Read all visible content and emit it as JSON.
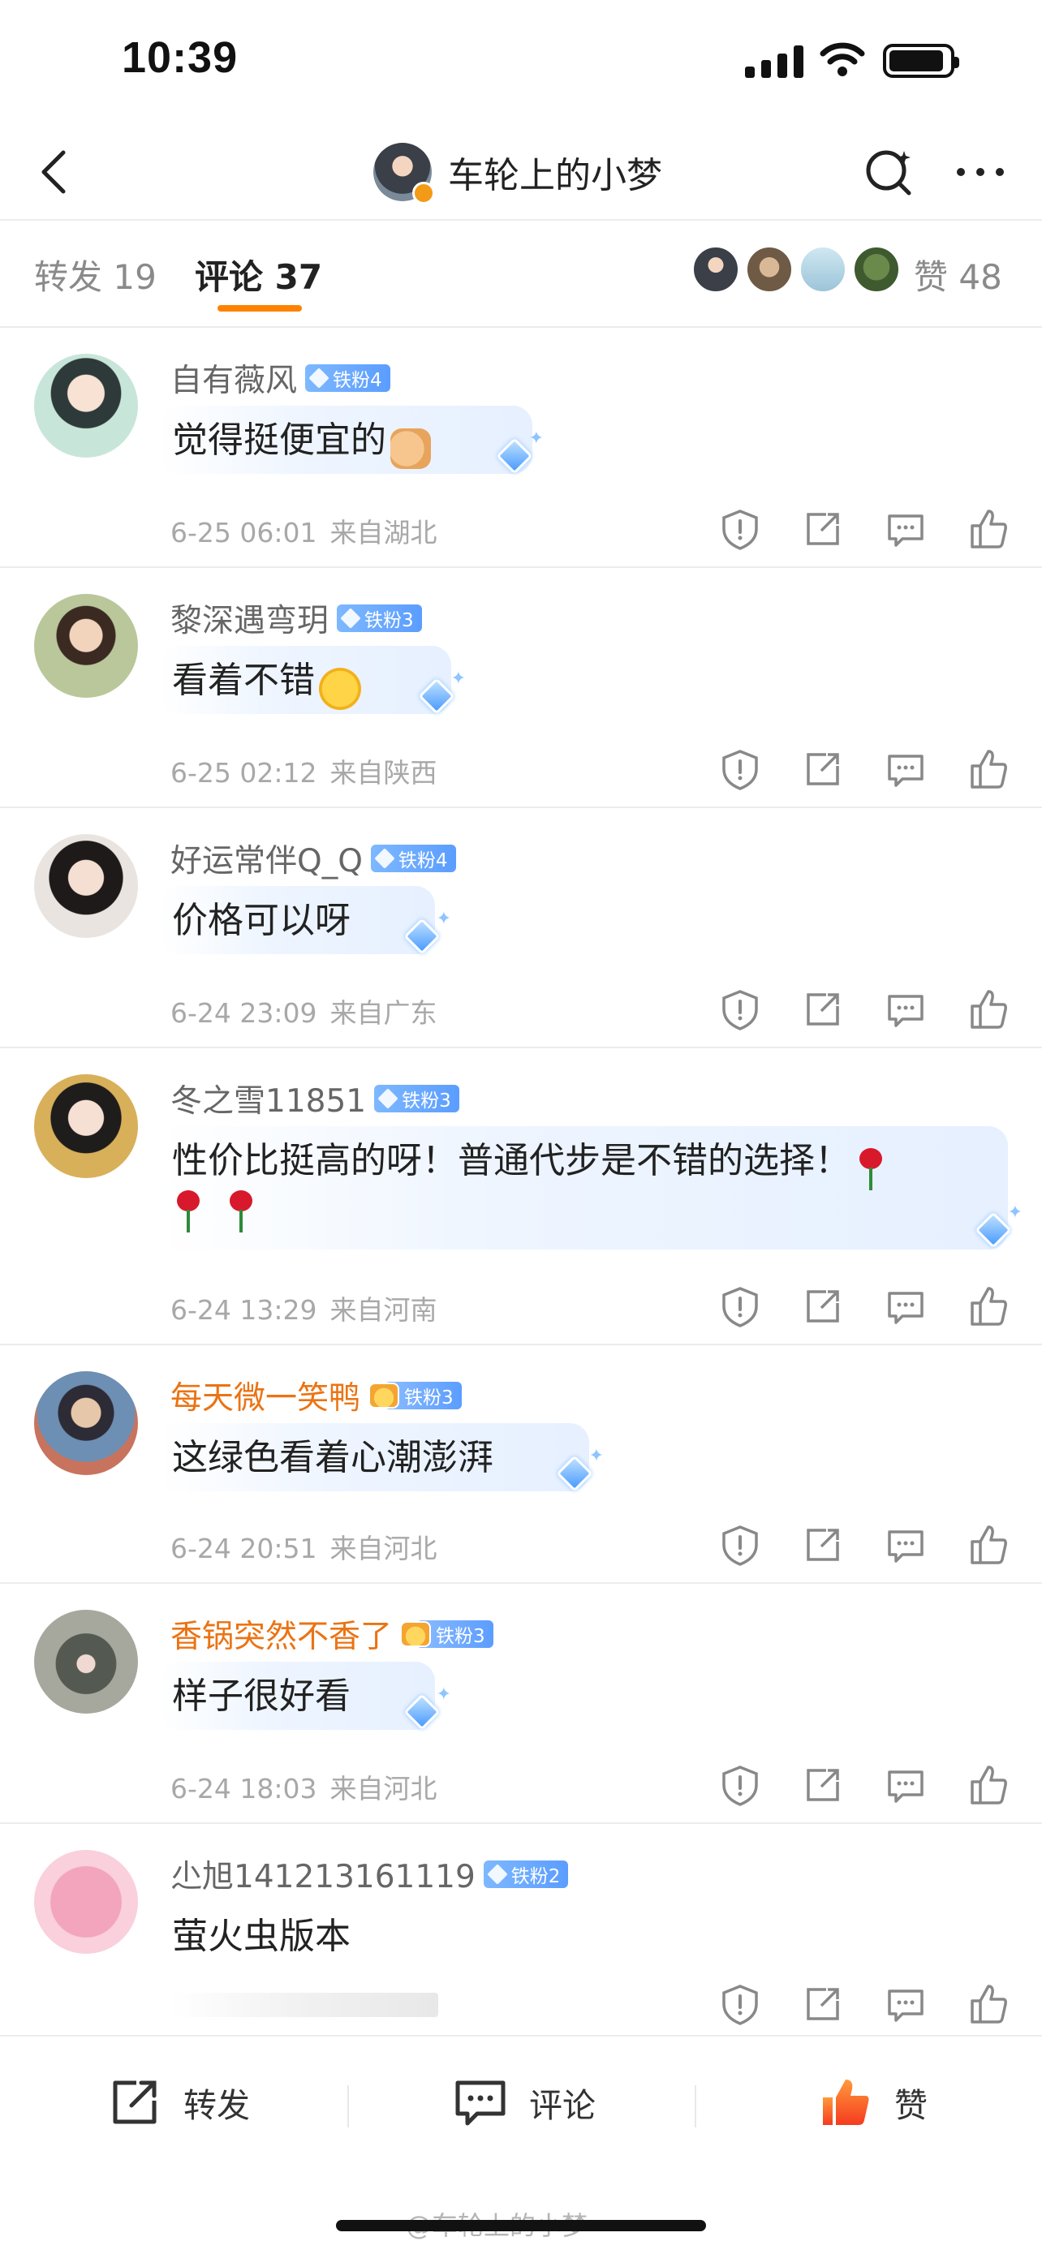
{
  "status_bar": {
    "time": "10:39"
  },
  "nav": {
    "title": "车轮上的小梦"
  },
  "tabs": {
    "repost": "转发 19",
    "comment": "评论 37",
    "like": "赞 48"
  },
  "comments": [
    {
      "name": "自有薇风",
      "name_color": "gray",
      "badge": "铁粉4",
      "text": "觉得挺便宜的",
      "emoji": "thumbs-up",
      "date": "6-25 06:01",
      "location": "来自湖北"
    },
    {
      "name": "黎深遇弯玥",
      "name_color": "gray",
      "badge": "铁粉3",
      "text": "看着不错",
      "emoji": "laughing-tears",
      "date": "6-25 02:12",
      "location": "来自陕西"
    },
    {
      "name": "好运常伴Q_Q",
      "name_color": "gray",
      "badge": "铁粉4",
      "text": "价格可以呀",
      "emoji": "",
      "date": "6-24 23:09",
      "location": "来自广东"
    },
    {
      "name": "冬之雪11851",
      "name_color": "gray",
      "badge": "铁粉3",
      "text": "性价比挺高的呀！普通代步是不错的选择！",
      "emoji": "rose",
      "date": "6-24 13:29",
      "location": "来自河南"
    },
    {
      "name": "每天微一笑鸭",
      "name_color": "orange",
      "badge": "铁粉3",
      "text": "这绿色看着心潮澎湃",
      "emoji": "",
      "date": "6-24 20:51",
      "location": "来自河北"
    },
    {
      "name": "香锅突然不香了",
      "name_color": "orange",
      "badge": "铁粉3",
      "text": "样子很好看",
      "emoji": "",
      "date": "6-24 18:03",
      "location": "来自河北"
    },
    {
      "name": "尐旭141213161119",
      "name_color": "gray",
      "badge": "铁粉2",
      "text": "萤火虫版本",
      "emoji": "",
      "date": "",
      "location": ""
    }
  ],
  "toolbar": {
    "repost": "转发",
    "comment": "评论",
    "like": "赞"
  },
  "watermark": "@车轮上的小梦",
  "colors": {
    "accent": "#ff8200",
    "badge_blue": "#5b9dff",
    "vip_orange": "#eb7313"
  }
}
